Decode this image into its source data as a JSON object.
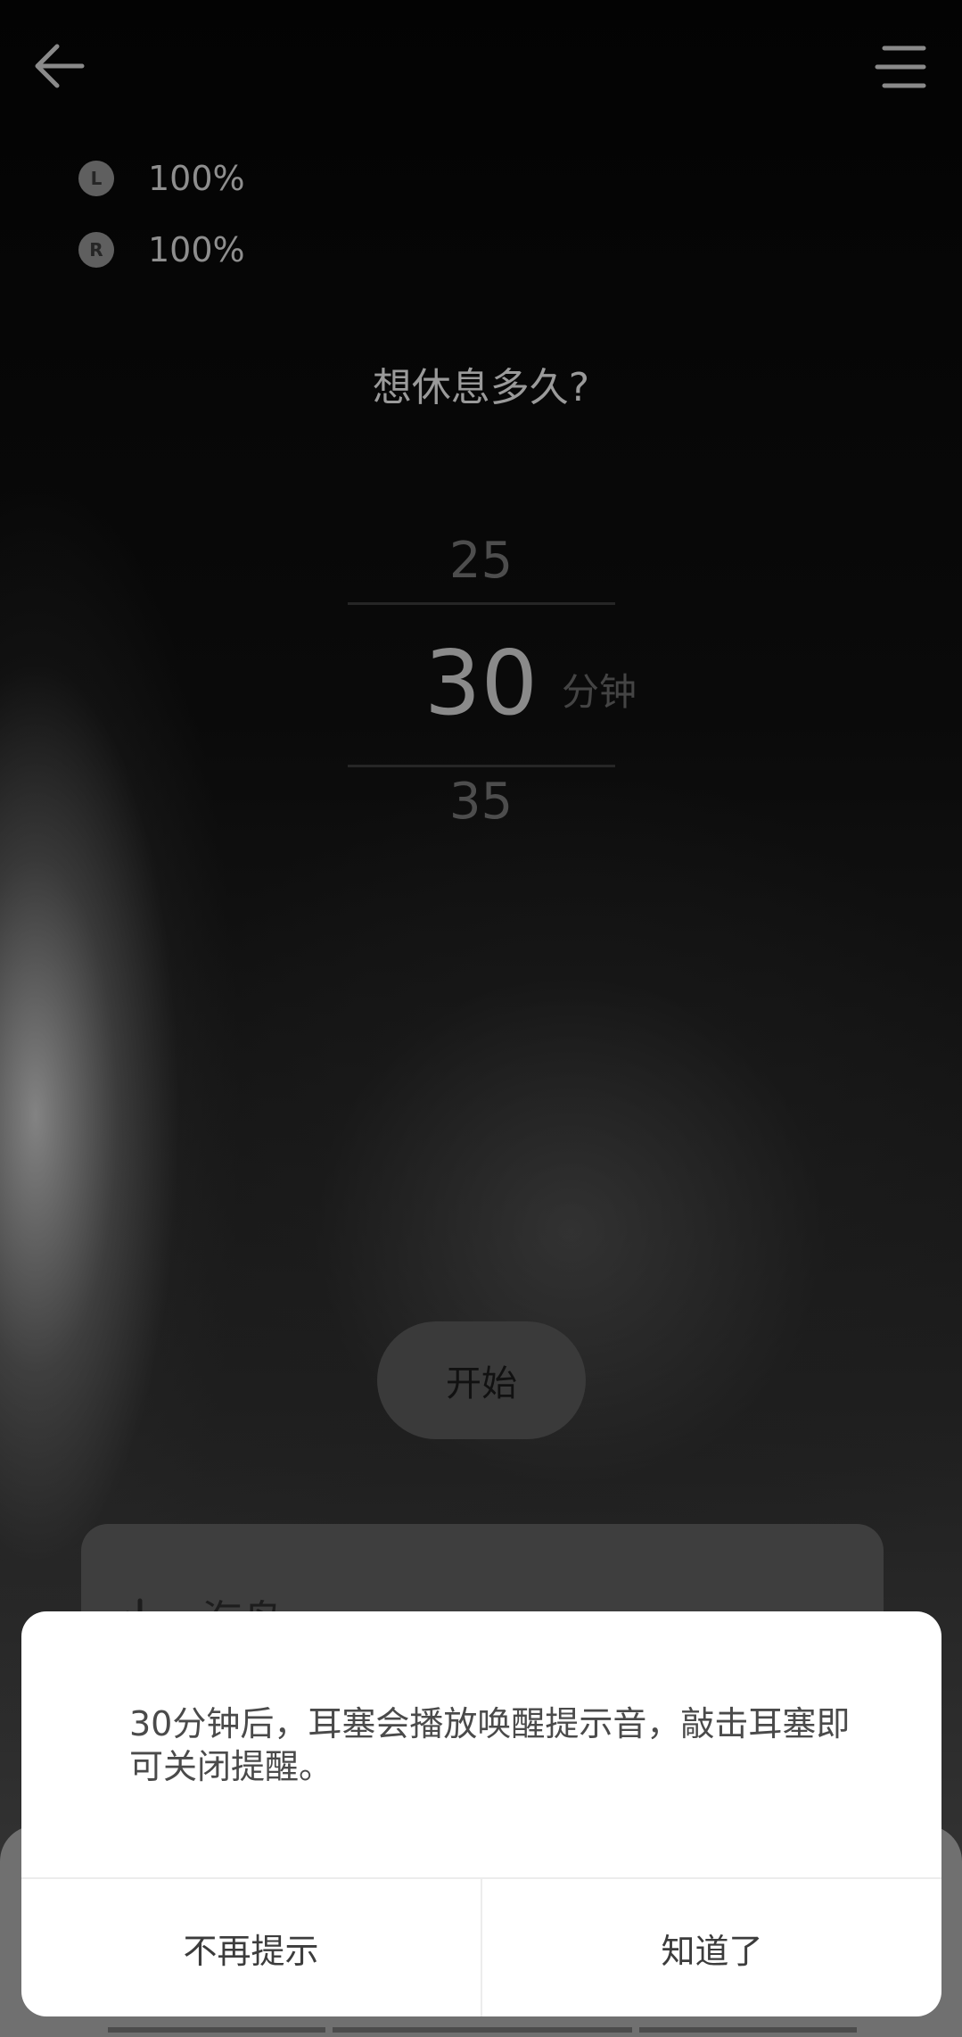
{
  "battery": {
    "left": {
      "badge": "L",
      "value": "100%"
    },
    "right": {
      "badge": "R",
      "value": "100%"
    }
  },
  "question": "想休息多久?",
  "picker": {
    "prev": "25",
    "current": "30",
    "next": "35",
    "unit": "分钟"
  },
  "start_button": "开始",
  "card": {
    "title": "海鸟"
  },
  "dialog": {
    "message": "30分钟后，耳塞会播放唤醒提示音，敲击耳塞即可关闭提醒。",
    "dismiss_forever": "不再提示",
    "confirm": "知道了"
  },
  "icons": {
    "back": "arrow-left-icon",
    "menu": "menu-icon",
    "card": "sound-bars-icon"
  },
  "colors": {
    "background": "#000000",
    "dialog_bg": "#ffffff",
    "start_button_bg": "#3a3a3a"
  }
}
